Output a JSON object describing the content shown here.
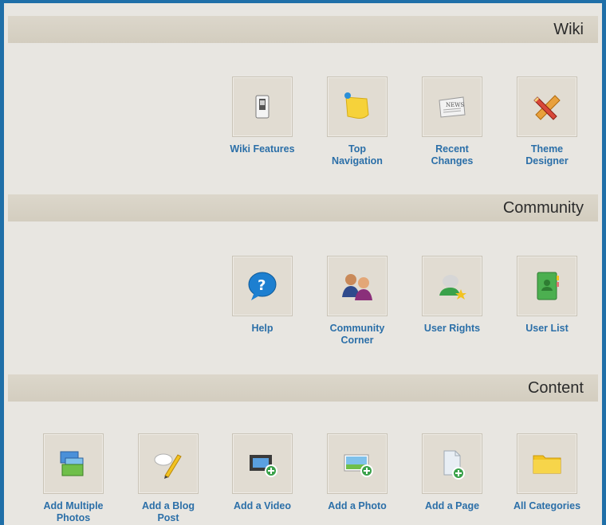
{
  "sections": [
    {
      "title": "Wiki",
      "items": [
        {
          "label": "Wiki Features",
          "icon": "feature-switch-icon"
        },
        {
          "label": "Top\nNavigation",
          "icon": "sticky-note-icon"
        },
        {
          "label": "Recent\nChanges",
          "icon": "newspaper-icon"
        },
        {
          "label": "Theme\nDesigner",
          "icon": "pencil-ruler-icon"
        }
      ]
    },
    {
      "title": "Community",
      "items": [
        {
          "label": "Help",
          "icon": "help-bubble-icon"
        },
        {
          "label": "Community\nCorner",
          "icon": "people-icon"
        },
        {
          "label": "User Rights",
          "icon": "user-rights-icon"
        },
        {
          "label": "User List",
          "icon": "address-book-icon"
        }
      ]
    },
    {
      "title": "Content",
      "items": [
        {
          "label": "Add Multiple\nPhotos",
          "icon": "multiple-photos-icon"
        },
        {
          "label": "Add a Blog\nPost",
          "icon": "blog-post-icon"
        },
        {
          "label": "Add a Video",
          "icon": "add-video-icon"
        },
        {
          "label": "Add a Photo",
          "icon": "add-photo-icon"
        },
        {
          "label": "Add a Page",
          "icon": "add-page-icon"
        },
        {
          "label": "All Categories",
          "icon": "folder-icon"
        }
      ]
    }
  ],
  "colors": {
    "frame": "#1f6fa8",
    "link": "#2b6fa8",
    "header": "#d8d2c5",
    "background": "#e8e6e1"
  }
}
